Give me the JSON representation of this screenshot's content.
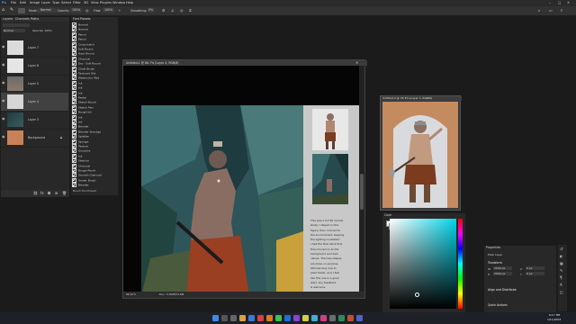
{
  "menubar": {
    "items": [
      "File",
      "Edit",
      "Image",
      "Layer",
      "Type",
      "Select",
      "Filter",
      "3D",
      "View",
      "Plugins",
      "Window",
      "Help"
    ]
  },
  "optbar": {
    "mode_label": "Mode:",
    "mode_value": "Normal",
    "opacity_label": "Opacity:",
    "opacity_value": "100%",
    "flow_label": "Flow:",
    "flow_value": "100%",
    "smoothing_label": "Smoothing:",
    "smoothing_value": "0%"
  },
  "layers_panel": {
    "tabs": [
      "Layers",
      "Channels",
      "Paths"
    ],
    "blend": "Normal",
    "opacity": "Opacity: 100%",
    "layers": [
      {
        "name": "Layer 7",
        "thumb": "#dcdcdc"
      },
      {
        "name": "Layer 6",
        "thumb": "#e6e6e6"
      },
      {
        "name": "Layer 5",
        "thumb": "#8a7a6a"
      },
      {
        "name": "Layer 4",
        "thumb": "#d6d6d6"
      },
      {
        "name": "Layer 3",
        "thumb": "#2c4c50"
      },
      {
        "name": "Background",
        "thumb": "#c8825a"
      }
    ]
  },
  "font_panel": {
    "title": "Font Presets",
    "rows": [
      "Normal",
      "Normal",
      "Pencil",
      "Pencil",
      "Cross-hatch",
      "Soft Round",
      "Hard Round",
      "Charcoal",
      "Dry - Soft Round",
      "Chalk Brush",
      "Textured Oils",
      "Watercolor Wet",
      "Ink",
      "Ink",
      "Ink",
      "Pastel",
      "Sketch Brush",
      "Sketch Pen",
      "Rough Ink",
      "Ink",
      "Ink",
      "Blender",
      "Blender Smudge",
      "Splatter",
      "Sponge",
      "Texture",
      "Gouache",
      "Ink",
      "Sketchy",
      "Charcoal",
      "Rough Pencil",
      "Smooth Charcoal",
      "Smear Brush",
      "Blender"
    ],
    "footer": "Brush Tool Preset"
  },
  "main_doc": {
    "title": "Untitled-1 @ 66.7% (Layer 4, RGB/8)",
    "zoom": "66.67%",
    "status": "Doc: 3.30M/53.6M",
    "notes": [
      "This was a full 90 minute",
      "study. I stayed on the",
      "figure, then I moved to",
      "the environment, keeping",
      "the lighting consistent.",
      "I had the face block first",
      "then moved on to the",
      "background and dark",
      "values. The tree shapes",
      "are loose on purpose.",
      "Still learning how to",
      "paint faster, and I feel",
      "like this one is a good",
      "start. Any feedback",
      "is welcome."
    ]
  },
  "ref_doc": {
    "title": "Untitled-2 @ 33.3% (Layer 1, RGB/8)"
  },
  "color_panel": {
    "title": "Color"
  },
  "properties_panel": {
    "title": "Properties",
    "layer_label": "Pixel Layer",
    "transform_label": "Transform",
    "w_label": "W",
    "w_value": "2000 px",
    "h_label": "H",
    "h_value": "2000 px",
    "x_label": "X",
    "x_value": "0 px",
    "y_label": "Y",
    "y_value": "0 px",
    "align_label": "Align and Distribute",
    "quick_label": "Quick Actions"
  },
  "taskbar": {
    "time": "6:17 PM",
    "date": "1/11/2023"
  }
}
